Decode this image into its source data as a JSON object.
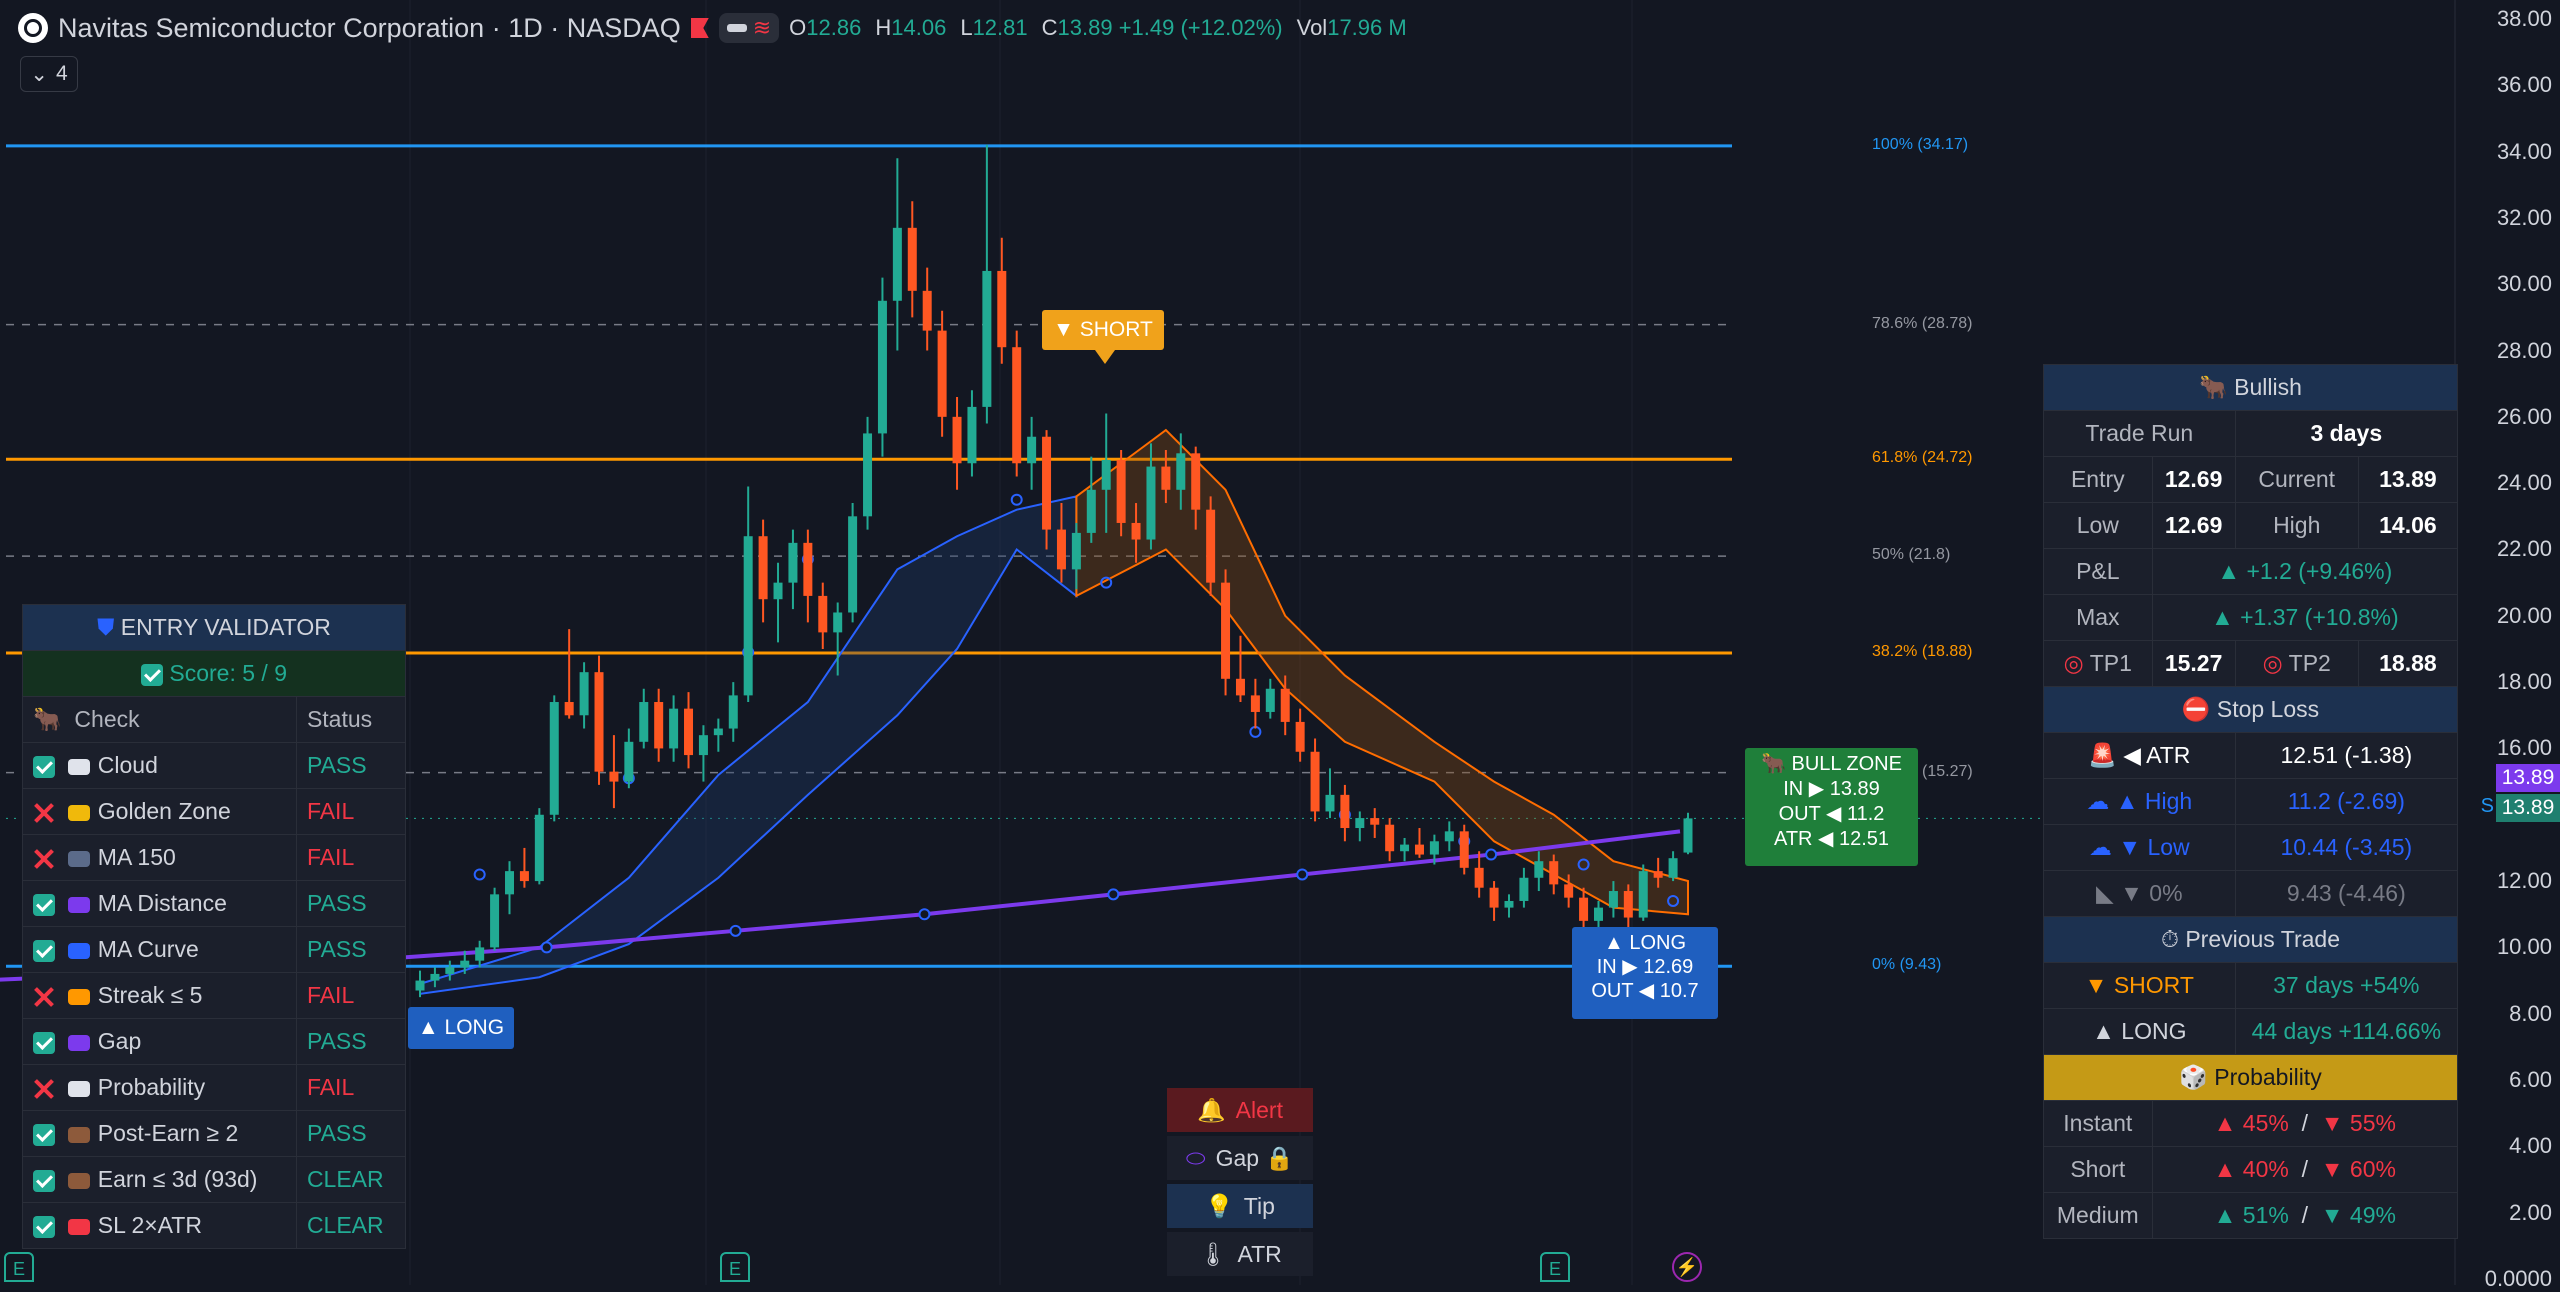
{
  "header": {
    "title": "Navitas Semiconductor Corporation · 1D · NASDAQ",
    "ohlc": {
      "o_label": "O",
      "o": "12.86",
      "h_label": "H",
      "h": "14.06",
      "l_label": "L",
      "l": "12.81",
      "c_label": "C",
      "c": "13.89",
      "chg": "+1.49 (+12.02%)",
      "vol_label": "Vol",
      "vol": "17.96 M"
    },
    "indicator_count": "4"
  },
  "colors": {
    "bg": "#131722",
    "up": "#22ab94",
    "down": "#ff5722",
    "orange_line": "#ff9800",
    "blue_line": "#2196f3",
    "ma": "#7c3aed"
  },
  "price_axis": [
    "38.00",
    "36.00",
    "34.00",
    "32.00",
    "30.00",
    "28.00",
    "26.00",
    "24.00",
    "22.00",
    "20.00",
    "18.00",
    "16.00",
    "14.00",
    "12.00",
    "10.00",
    "8.00",
    "6.00",
    "4.00",
    "2.00",
    "0.0000"
  ],
  "price_badges": {
    "current": "13.89",
    "last": "13.89",
    "last_prefix": "S"
  },
  "fib_levels": [
    {
      "label": "100% (34.17)",
      "price": 34.17,
      "color": "#2196f3",
      "style": "solid"
    },
    {
      "label": "78.6% (28.78)",
      "price": 28.78,
      "color": "#787b86",
      "style": "dashed"
    },
    {
      "label": "61.8% (24.72)",
      "price": 24.72,
      "color": "#ff9800",
      "style": "solid"
    },
    {
      "label": "50% (21.8)",
      "price": 21.8,
      "color": "#787b86",
      "style": "dashed"
    },
    {
      "label": "38.2% (18.88)",
      "price": 18.88,
      "color": "#ff9800",
      "style": "solid"
    },
    {
      "label": "(15.27)",
      "price": 15.27,
      "color": "#787b86",
      "style": "dashed"
    },
    {
      "label": "0% (9.43)",
      "price": 9.43,
      "color": "#2196f3",
      "style": "solid"
    }
  ],
  "candles": [
    [
      8.7,
      9.3,
      8.5,
      9.0
    ],
    [
      9.0,
      9.4,
      8.8,
      9.2
    ],
    [
      9.2,
      9.6,
      9.0,
      9.4
    ],
    [
      9.4,
      9.9,
      9.2,
      9.6
    ],
    [
      9.6,
      10.2,
      9.4,
      10.0
    ],
    [
      10.0,
      11.8,
      9.9,
      11.6
    ],
    [
      11.6,
      12.6,
      11.0,
      12.3
    ],
    [
      12.3,
      13.0,
      11.8,
      12.0
    ],
    [
      12.0,
      14.2,
      11.9,
      14.0
    ],
    [
      14.0,
      17.6,
      13.8,
      17.4
    ],
    [
      17.4,
      19.6,
      16.9,
      17.0
    ],
    [
      17.0,
      18.6,
      16.6,
      18.3
    ],
    [
      18.3,
      18.8,
      14.9,
      15.3
    ],
    [
      15.3,
      16.4,
      14.2,
      15.0
    ],
    [
      15.0,
      16.6,
      14.8,
      16.2
    ],
    [
      16.2,
      17.8,
      16.0,
      17.4
    ],
    [
      17.4,
      17.8,
      15.6,
      16.0
    ],
    [
      16.0,
      17.6,
      15.6,
      17.2
    ],
    [
      17.2,
      17.7,
      15.4,
      15.8
    ],
    [
      15.8,
      16.7,
      15.0,
      16.4
    ],
    [
      16.4,
      16.9,
      15.9,
      16.6
    ],
    [
      16.6,
      18.0,
      16.2,
      17.6
    ],
    [
      17.6,
      23.9,
      17.4,
      22.4
    ],
    [
      22.4,
      22.9,
      19.8,
      20.5
    ],
    [
      20.5,
      21.6,
      19.2,
      21.0
    ],
    [
      21.0,
      22.6,
      20.2,
      22.2
    ],
    [
      22.2,
      22.6,
      19.8,
      20.6
    ],
    [
      20.6,
      21.0,
      19.0,
      19.5
    ],
    [
      19.5,
      20.4,
      18.2,
      20.1
    ],
    [
      20.1,
      23.4,
      19.8,
      23.0
    ],
    [
      23.0,
      26.0,
      22.6,
      25.5
    ],
    [
      25.5,
      30.2,
      24.8,
      29.5
    ],
    [
      29.5,
      33.8,
      28.0,
      31.7
    ],
    [
      31.7,
      32.5,
      29.0,
      29.8
    ],
    [
      29.8,
      30.5,
      28.0,
      28.6
    ],
    [
      28.6,
      29.2,
      25.4,
      26.0
    ],
    [
      26.0,
      26.6,
      23.8,
      24.6
    ],
    [
      24.6,
      26.8,
      24.2,
      26.3
    ],
    [
      26.3,
      34.2,
      25.8,
      30.4
    ],
    [
      30.4,
      31.4,
      27.6,
      28.1
    ],
    [
      28.1,
      28.6,
      24.2,
      24.6
    ],
    [
      24.6,
      26.0,
      23.8,
      25.4
    ],
    [
      25.4,
      25.6,
      22.0,
      22.6
    ],
    [
      22.6,
      23.4,
      21.0,
      21.4
    ],
    [
      21.4,
      22.8,
      20.8,
      22.5
    ],
    [
      22.5,
      24.8,
      22.2,
      23.8
    ],
    [
      23.8,
      26.1,
      22.5,
      24.7
    ],
    [
      24.7,
      25.0,
      22.4,
      22.8
    ],
    [
      22.8,
      23.4,
      21.6,
      22.3
    ],
    [
      22.3,
      25.2,
      22.0,
      24.5
    ],
    [
      24.5,
      25.0,
      23.4,
      23.8
    ],
    [
      23.8,
      25.5,
      23.2,
      24.9
    ],
    [
      24.9,
      25.1,
      22.6,
      23.2
    ],
    [
      23.2,
      23.6,
      20.6,
      21.0
    ],
    [
      21.0,
      21.4,
      17.6,
      18.1
    ],
    [
      18.1,
      19.4,
      17.4,
      17.6
    ],
    [
      17.6,
      18.1,
      16.6,
      17.1
    ],
    [
      17.1,
      18.1,
      16.9,
      17.8
    ],
    [
      17.8,
      18.2,
      16.4,
      16.8
    ],
    [
      16.8,
      17.2,
      15.6,
      15.9
    ],
    [
      15.9,
      16.3,
      13.8,
      14.1
    ],
    [
      14.1,
      15.4,
      13.9,
      14.6
    ],
    [
      14.6,
      14.9,
      13.2,
      13.6
    ],
    [
      13.6,
      14.1,
      13.2,
      13.9
    ],
    [
      13.9,
      14.2,
      13.3,
      13.7
    ],
    [
      13.7,
      13.9,
      12.6,
      12.9
    ],
    [
      12.9,
      13.3,
      12.6,
      13.1
    ],
    [
      13.1,
      13.6,
      12.7,
      12.8
    ],
    [
      12.8,
      13.4,
      12.5,
      13.2
    ],
    [
      13.2,
      13.8,
      12.9,
      13.5
    ],
    [
      13.5,
      13.7,
      12.2,
      12.4
    ],
    [
      12.4,
      12.9,
      11.5,
      11.8
    ],
    [
      11.8,
      12.0,
      10.8,
      11.2
    ],
    [
      11.2,
      11.6,
      10.9,
      11.4
    ],
    [
      11.4,
      12.4,
      11.2,
      12.1
    ],
    [
      12.1,
      12.9,
      11.7,
      12.6
    ],
    [
      12.6,
      12.8,
      11.6,
      11.9
    ],
    [
      11.9,
      12.2,
      11.2,
      11.5
    ],
    [
      11.5,
      11.8,
      10.6,
      10.8
    ],
    [
      10.8,
      11.4,
      10.4,
      11.2
    ],
    [
      11.2,
      12.0,
      10.9,
      11.7
    ],
    [
      11.7,
      11.9,
      10.6,
      10.9
    ],
    [
      10.9,
      12.5,
      10.8,
      12.3
    ],
    [
      12.3,
      12.7,
      11.8,
      12.1
    ],
    [
      12.1,
      12.9,
      12.0,
      12.69
    ],
    [
      12.86,
      14.06,
      12.81,
      13.89
    ]
  ],
  "ma_curve": [
    9.0,
    9.25,
    9.6,
    10.0,
    10.5,
    11.0,
    11.6,
    12.2,
    12.8,
    13.5
  ],
  "labels": {
    "short": "▼ SHORT",
    "long_left": "▲ LONG",
    "long_right": {
      "line1": "▲ LONG",
      "line2": "IN ▶ 12.69",
      "line3": "OUT ◀ 10.7"
    },
    "bull_zone": {
      "line1": "🐂 BULL ZONE",
      "line2": "IN ▶ 13.89",
      "line3": "OUT ◀ 11.2",
      "line4": "ATR ◀ 12.51"
    }
  },
  "middle_buttons": [
    {
      "icon": "🔔",
      "label": "Alert",
      "bg": "#5a1a1f",
      "color": "#f23645"
    },
    {
      "icon": "⬭",
      "label": "Gap 🔒",
      "bg": "#1b1f2b",
      "color": "#d1d4dc"
    },
    {
      "icon": "💡",
      "label": "Tip",
      "bg": "#1c3150",
      "color": "#d1d4dc"
    },
    {
      "icon": "🌡",
      "label": "ATR",
      "bg": "#1b1f2b",
      "color": "#d1d4dc"
    }
  ],
  "validator": {
    "title": "ENTRY VALIDATOR",
    "score": "Score: 5 / 9",
    "col_check": "Check",
    "col_status": "Status",
    "rows": [
      {
        "name": "Cloud",
        "status": "PASS",
        "result": "pass",
        "icon_color": "#e0e3eb"
      },
      {
        "name": "Golden Zone",
        "status": "FAIL",
        "result": "fail",
        "icon_color": "#f0b90b"
      },
      {
        "name": "MA 150",
        "status": "FAIL",
        "result": "fail",
        "icon_color": "#5b6b8a"
      },
      {
        "name": "MA Distance",
        "status": "PASS",
        "result": "pass",
        "icon_color": "#7c3aed"
      },
      {
        "name": "MA Curve",
        "status": "PASS",
        "result": "pass",
        "icon_color": "#2962ff"
      },
      {
        "name": "Streak ≤ 5",
        "status": "FAIL",
        "result": "fail",
        "icon_color": "#ff9800"
      },
      {
        "name": "Gap",
        "status": "PASS",
        "result": "pass",
        "icon_color": "#7c3aed"
      },
      {
        "name": "Probability",
        "status": "FAIL",
        "result": "fail",
        "icon_color": "#e0e3eb"
      },
      {
        "name": "Post-Earn ≥ 2",
        "status": "PASS",
        "result": "pass",
        "icon_color": "#8d5a3b"
      },
      {
        "name": "Earn ≤ 3d (93d)",
        "status": "CLEAR",
        "result": "pass",
        "icon_color": "#8d5a3b"
      },
      {
        "name": "SL 2×ATR",
        "status": "CLEAR",
        "result": "pass",
        "icon_color": "#f23645"
      }
    ]
  },
  "bull_panel": {
    "title": "🐂 Bullish",
    "trade_run_label": "Trade Run",
    "trade_run": "3 days",
    "entry_label": "Entry",
    "entry": "12.69",
    "current_label": "Current",
    "current": "13.89",
    "low_label": "Low",
    "low": "12.69",
    "high_label": "High",
    "high": "14.06",
    "pnl_label": "P&L",
    "pnl": "▲ +1.2  (+9.46%)",
    "max_label": "Max",
    "max": "▲ +1.37  (+10.8%)",
    "tp1_label": "TP1",
    "tp1": "15.27",
    "tp2_label": "TP2",
    "tp2": "18.88",
    "stop_loss_title": "⛔ Stop Loss",
    "sl_rows": [
      {
        "label": "◀ ATR",
        "value": "12.51  (-1.38)"
      },
      {
        "label": "▲ High",
        "value": "11.2  (-2.69)"
      },
      {
        "label": "▼ Low",
        "value": "10.44  (-3.45)"
      },
      {
        "label": "▼ 0%",
        "value": "9.43  (-4.46)"
      }
    ],
    "prev_trade_title": "Previous Trade",
    "prev": [
      {
        "dir": "▼ SHORT",
        "result": "37 days  +54%"
      },
      {
        "dir": "▲ LONG",
        "result": "44 days  +114.66%"
      }
    ],
    "prob_title": "🎲 Probability",
    "prob": [
      {
        "label": "Instant",
        "up": "▲ 45%",
        "sep": "/",
        "down": "▼ 55%"
      },
      {
        "label": "Short",
        "up": "▲ 40%",
        "sep": "/",
        "down": "▼ 60%"
      },
      {
        "label": "Medium",
        "up": "▲ 51%",
        "sep": "/",
        "down": "▼ 49%"
      }
    ]
  }
}
